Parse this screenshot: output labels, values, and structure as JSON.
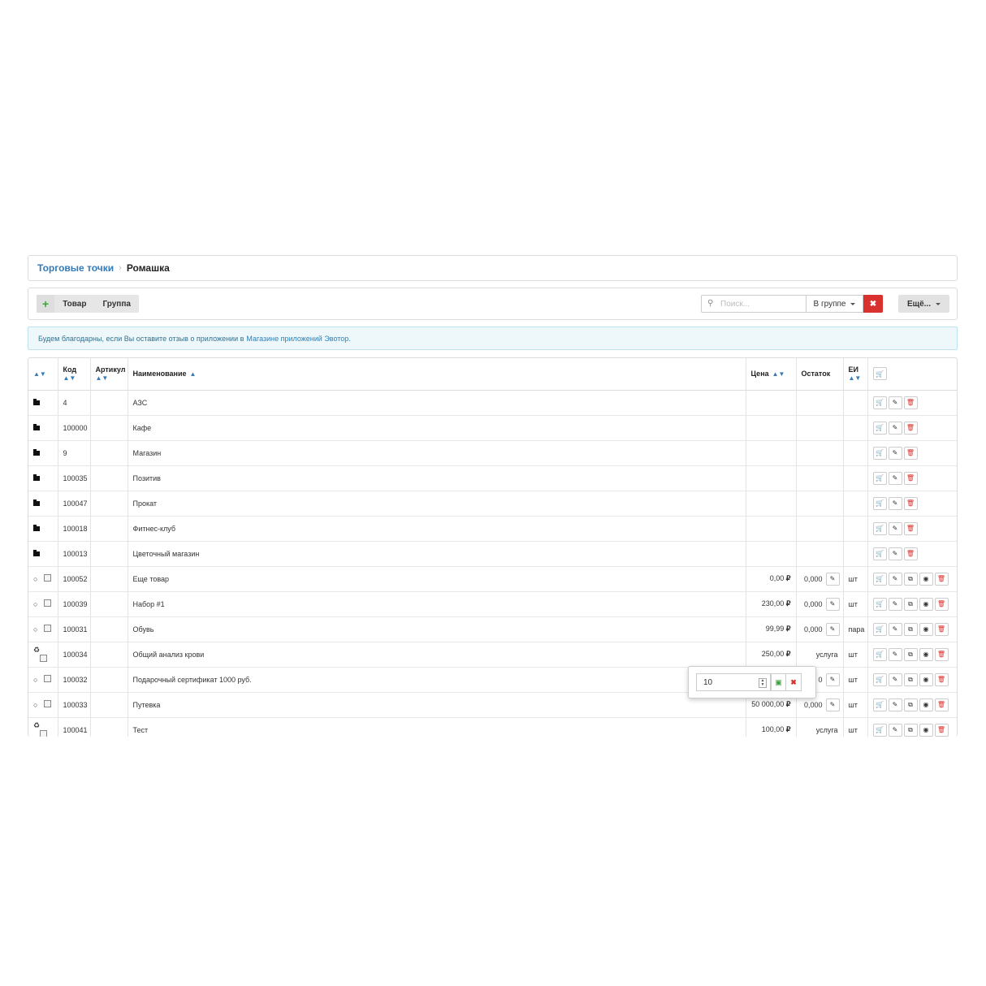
{
  "breadcrumb": {
    "parent": "Торговые точки",
    "separator": "›",
    "current": "Ромашка"
  },
  "toolbar": {
    "add_label": "+",
    "product_label": "Товар",
    "group_label": "Группа",
    "search_placeholder": "Поиск...",
    "search_icon": "search-icon",
    "scope_label": "В группе",
    "clear_label": "✖",
    "more_label": "Ещё..."
  },
  "notice": {
    "text": "Будем благодарны, если Вы оставите отзыв о приложении в",
    "link": "Магазине приложений Эвотор."
  },
  "table": {
    "headers": {
      "code": "Код",
      "article": "Артикул",
      "name": "Наименование",
      "price": "Цена",
      "stock": "Остаток",
      "unit": "ЕИ"
    },
    "groups": [
      {
        "code": "4",
        "name": "АЗС"
      },
      {
        "code": "100000",
        "name": "Кафе"
      },
      {
        "code": "9",
        "name": "Магазин"
      },
      {
        "code": "100035",
        "name": "Позитив"
      },
      {
        "code": "100047",
        "name": "Прокат"
      },
      {
        "code": "100018",
        "name": "Фитнес-клуб"
      },
      {
        "code": "100013",
        "name": "Цветочный магазин"
      }
    ],
    "items": [
      {
        "type_icon": "○",
        "code": "100052",
        "name": "Еще товар",
        "price": "0,00",
        "currency": "₽",
        "stock": "0,000",
        "unit": "шт"
      },
      {
        "type_icon": "○",
        "code": "100039",
        "name": "Набор #1",
        "price": "230,00",
        "currency": "₽",
        "stock": "0,000",
        "unit": "шт"
      },
      {
        "type_icon": "○",
        "code": "100031",
        "name": "Обувь",
        "price": "99,99",
        "currency": "₽",
        "stock": "0,000",
        "unit": "пара"
      },
      {
        "type_icon": "♻",
        "code": "100034",
        "name": "Общий анализ крови",
        "price": "250,00",
        "currency": "₽",
        "stock": "услуга",
        "unit": "шт"
      },
      {
        "type_icon": "○",
        "code": "100032",
        "name": "Подарочный сертификат 1000 руб.",
        "price": "",
        "currency": "",
        "stock": "0",
        "unit": "шт"
      },
      {
        "type_icon": "○",
        "code": "100033",
        "name": "Путевка",
        "price": "50 000,00",
        "currency": "₽",
        "stock": "0,000",
        "unit": "шт"
      },
      {
        "type_icon": "♻",
        "code": "100041",
        "name": "Тест",
        "price": "100,00",
        "currency": "₽",
        "stock": "услуга",
        "unit": "шт"
      }
    ]
  },
  "popover": {
    "value": "10"
  },
  "colors": {
    "link": "#337ab7",
    "danger": "#d9312d",
    "success": "#3aa63a",
    "notice_bg": "#eef8fb"
  }
}
